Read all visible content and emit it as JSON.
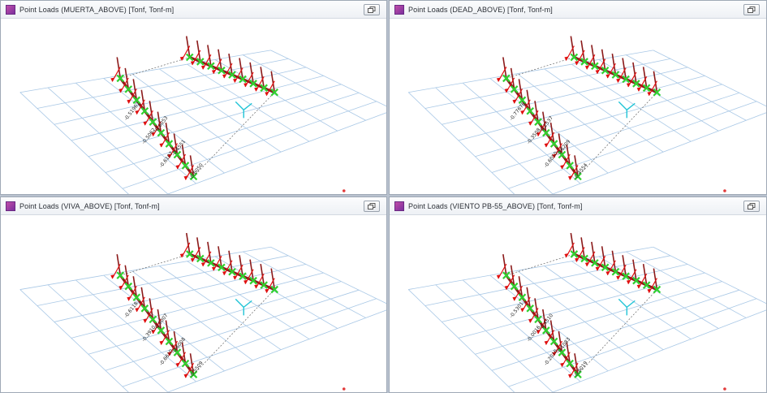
{
  "windows": [
    {
      "title": "Point Loads (MUERTA_ABOVE)  [Tonf,  Tonf-m]",
      "labels": [
        "-0.51967",
        "-0.6053",
        "-0.5062",
        "-0.4551",
        "-0.6107",
        "-0.6050"
      ]
    },
    {
      "title": "Point Loads (DEAD_ABOVE)  [Tonf,  Tonf-m]",
      "labels": [
        "-0.77676",
        "-0.2537",
        "-0.3508",
        "-0.6209",
        "-0.6050",
        "-0.4554"
      ]
    },
    {
      "title": "Point Loads (VIVA_ABOVE)  [Tonf,  Tonf-m]",
      "labels": [
        "-0.6118",
        "-0.9007",
        "-0.3910",
        "-0.6008",
        "-0.6610",
        "-0.5509"
      ]
    },
    {
      "title": "Point Loads (VIENTO PB-55_ABOVE)  [Tonf,  Tonf-m]",
      "labels": [
        "-0.5301",
        "-0.4510",
        "-0.0016",
        "-0.1083",
        "-0.2016",
        "-0.6019"
      ]
    }
  ],
  "icons": {
    "window": "app-icon",
    "restore": "restore-icon"
  },
  "colors": {
    "grid": "#a9c8e6",
    "member": "#8b1a1a",
    "load_arrow": "#e01010",
    "restraint": "#2fd12f",
    "axes": "#21c4d6"
  }
}
